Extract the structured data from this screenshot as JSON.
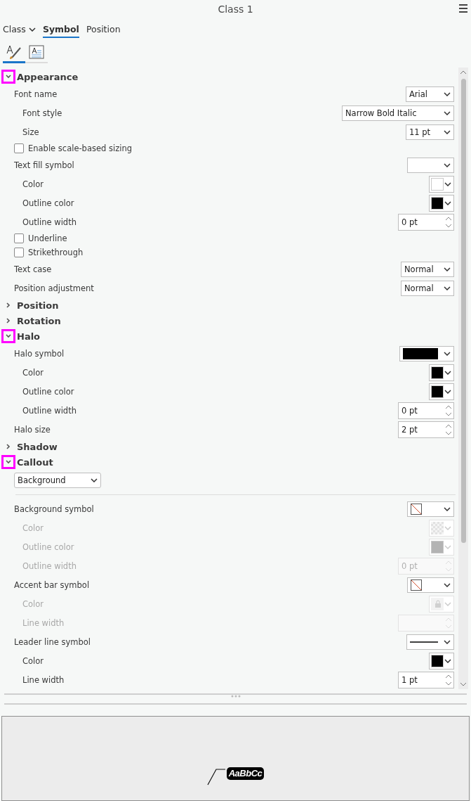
{
  "window": {
    "title": "Class 1"
  },
  "tabs": [
    {
      "label": "Class",
      "kind": "dropdown",
      "selected": false
    },
    {
      "label": "Symbol",
      "kind": "tab",
      "selected": true
    },
    {
      "label": "Position",
      "kind": "tab",
      "selected": false
    }
  ],
  "icon_tabs": [
    {
      "kind": "brush",
      "selected": true
    },
    {
      "kind": "text-frame",
      "selected": false
    }
  ],
  "sections": [
    {
      "title": "Appearance",
      "expanded": true,
      "highlighted": true,
      "rows": [
        {
          "kind": "dropdown",
          "label": "Font name",
          "value": "Arial",
          "disabled": false,
          "children": [
            {
              "kind": "dropdown",
              "label": "Font style",
              "value": "Narrow Bold Italic",
              "disabled": false
            },
            {
              "kind": "dropdown",
              "label": "Size",
              "value": "11 pt",
              "disabled": false
            }
          ]
        },
        {
          "kind": "checkbox",
          "label": "Enable scale-based sizing",
          "checked": false
        },
        {
          "kind": "symbol",
          "label": "Text fill symbol",
          "disabled": false,
          "children": [
            {
              "kind": "swatch",
              "label": "Color",
              "color": "#ffffff",
              "disabled": false
            },
            {
              "kind": "swatch",
              "label": "Outline color",
              "color": "#000000",
              "disabled": false
            },
            {
              "kind": "spinner",
              "label": "Outline width",
              "value": "0 pt",
              "disabled": false
            }
          ]
        },
        {
          "kind": "checkbox",
          "label": "Underline",
          "checked": false
        },
        {
          "kind": "checkbox",
          "label": "Strikethrough",
          "checked": false
        },
        {
          "kind": "dropdown",
          "label": "Text case",
          "value": "Normal",
          "disabled": false
        },
        {
          "kind": "dropdown",
          "label": "Position adjustment",
          "value": "Normal",
          "disabled": false
        }
      ]
    },
    {
      "title": "Position",
      "expanded": false,
      "highlighted": false
    },
    {
      "title": "Rotation",
      "expanded": false,
      "highlighted": false
    },
    {
      "title": "Halo",
      "expanded": true,
      "highlighted": true,
      "rows": [
        {
          "kind": "symbol",
          "label": "Halo symbol",
          "preview": {
            "kind": "solid"
          },
          "disabled": false,
          "children": [
            {
              "kind": "swatch",
              "label": "Color",
              "color": "#000000",
              "disabled": false
            },
            {
              "kind": "swatch",
              "label": "Outline color",
              "color": "#000000",
              "disabled": false
            },
            {
              "kind": "spinner",
              "label": "Outline width",
              "value": "0 pt",
              "disabled": false
            }
          ]
        },
        {
          "kind": "spinner",
          "label": "Halo size",
          "value": "2 pt",
          "disabled": false
        }
      ]
    },
    {
      "title": "Shadow",
      "expanded": false,
      "highlighted": false
    },
    {
      "title": "Callout",
      "expanded": true,
      "highlighted": true,
      "rows": [
        {
          "kind": "select",
          "value": "Background"
        },
        {
          "kind": "symbol",
          "label": "Background symbol",
          "preview": {
            "kind": "no-fill"
          },
          "disabled": false,
          "children": [
            {
              "kind": "swatch",
              "label": "Color",
              "pattern": {
                "kind": "checker"
              },
              "disabled": true
            },
            {
              "kind": "swatch",
              "label": "Outline color",
              "color": "#b3b3b3",
              "disabled": true
            },
            {
              "kind": "spinner",
              "label": "Outline width",
              "value": "0 pt",
              "disabled": true
            }
          ]
        },
        {
          "kind": "symbol",
          "label": "Accent bar symbol",
          "preview": {
            "kind": "no-fill"
          },
          "disabled": false,
          "children": [
            {
              "kind": "swatch",
              "label": "Color",
              "pattern": {
                "kind": "locked"
              },
              "disabled": true
            },
            {
              "kind": "spinner",
              "label": "Line width",
              "disabled": true
            }
          ]
        },
        {
          "kind": "symbol",
          "label": "Leader line symbol",
          "preview": {
            "kind": "line"
          },
          "disabled": false,
          "children": [
            {
              "kind": "swatch",
              "label": "Color",
              "color": "#000000",
              "disabled": false
            },
            {
              "kind": "spinner",
              "label": "Line width",
              "value": "1 pt",
              "disabled": false
            }
          ]
        }
      ]
    }
  ],
  "preview": {
    "sample": "AaBbCc"
  }
}
